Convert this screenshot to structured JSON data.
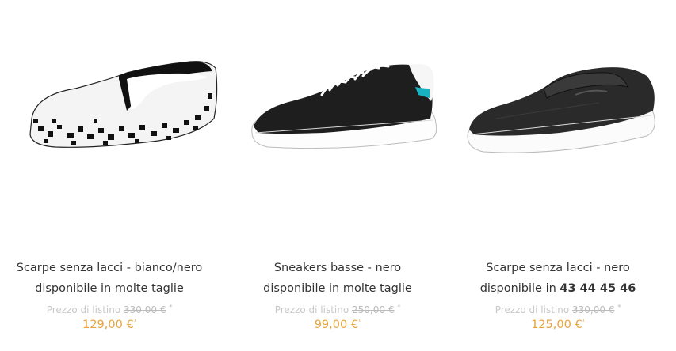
{
  "products": [
    {
      "name": "Scarpe senza lacci - bianco/nero",
      "availability_prefix": "disponibile in molte taglie",
      "availability_sizes": "",
      "list_label": "Prezzo di listino",
      "list_price": "330,00 €",
      "list_note": "*",
      "price": "129,00 €",
      "price_note": "¹",
      "image": "slip-on-white-black-snake-shoe"
    },
    {
      "name": "Sneakers basse - nero",
      "availability_prefix": "disponibile in molte taglie",
      "availability_sizes": "",
      "list_label": "Prezzo di listino",
      "list_price": "250,00 €",
      "list_note": "*",
      "price": "99,00 €",
      "price_note": "¹",
      "image": "black-low-sneaker-shoe"
    },
    {
      "name": "Scarpe senza lacci - nero",
      "availability_prefix": "disponibile in",
      "availability_sizes": "43 44 45 46",
      "list_label": "Prezzo di listino",
      "list_price": "330,00 €",
      "list_note": "*",
      "price": "125,00 €",
      "price_note": "¹",
      "image": "black-loafer-shoe"
    }
  ],
  "colors": {
    "price": "#e8a33d",
    "list": "#c8c8c8",
    "text": "#333333"
  }
}
